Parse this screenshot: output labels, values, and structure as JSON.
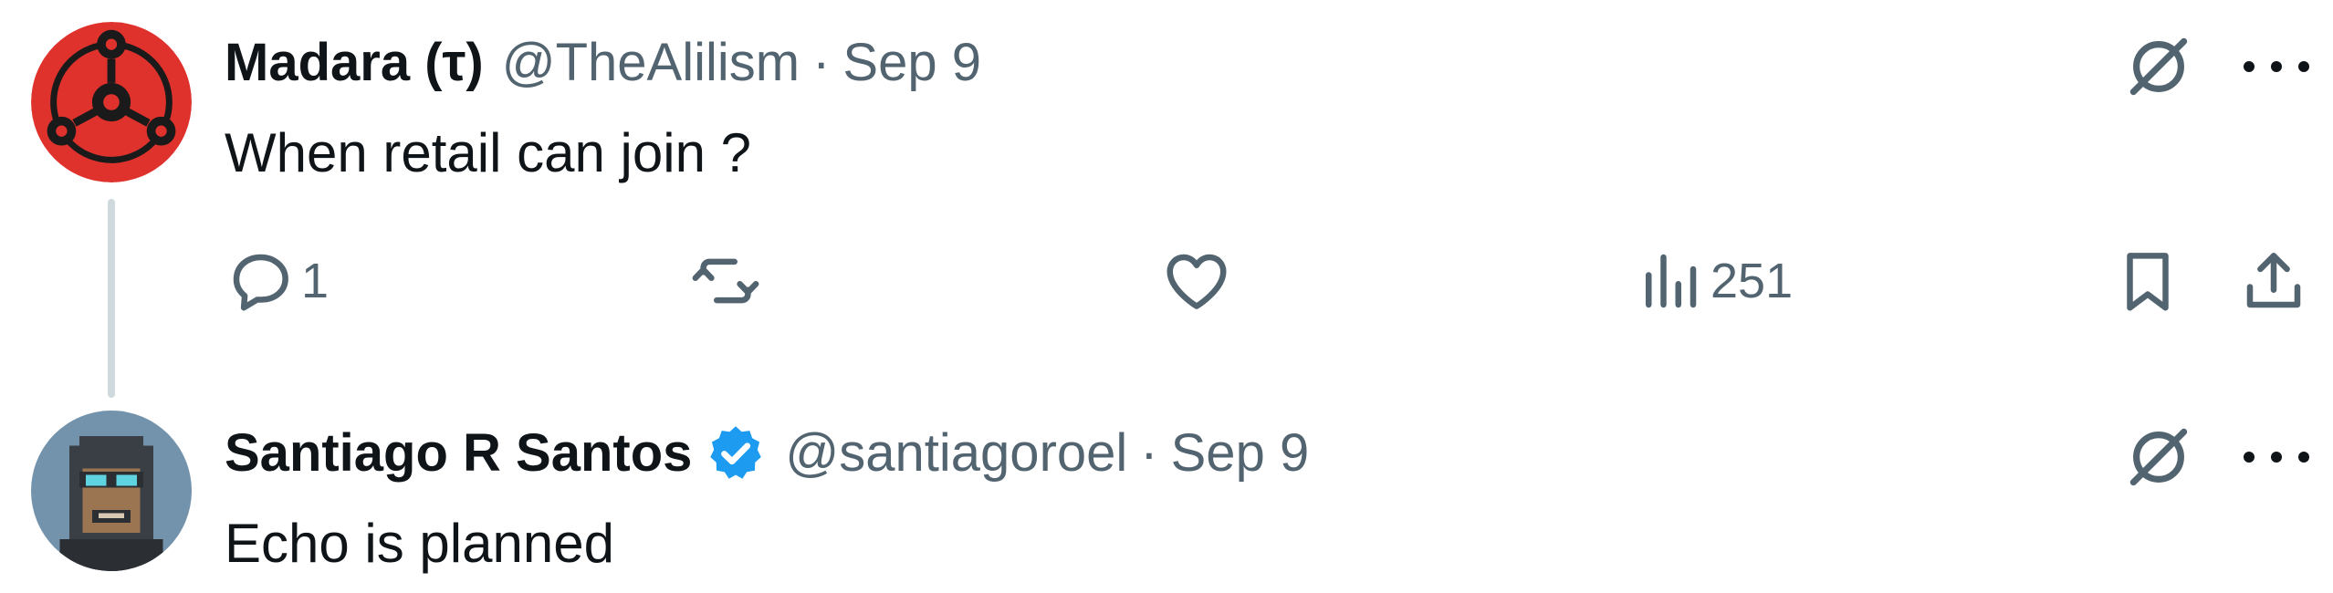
{
  "tweets": [
    {
      "display_name": "Madara (τ)",
      "handle": "@TheAlilism",
      "separator": "·",
      "time": "Sep 9",
      "text": "When retail can join ?",
      "avatar_icon": "sharingan-avatar",
      "verified": false,
      "actions": {
        "reply_count": "1",
        "views_count": "251"
      }
    },
    {
      "display_name": "Santiago R Santos",
      "handle": "@santiagoroel",
      "separator": "·",
      "time": "Sep 9",
      "text": "Echo is planned",
      "avatar_icon": "pixel-hooded-figure-avatar",
      "verified": true,
      "verified_icon": "verified-badge-icon"
    }
  ],
  "colors": {
    "text_primary": "#0f1419",
    "text_secondary": "#536471",
    "verified_blue": "#1d9bf0",
    "thread_line": "#cfd9de",
    "avatar_red": "#e0322d"
  },
  "icons": {
    "grok": "grok-icon",
    "more": "more-options-icon",
    "reply": "reply-icon",
    "retweet": "retweet-icon",
    "like": "heart-icon",
    "views": "views-chart-icon",
    "bookmark": "bookmark-icon",
    "share": "share-icon"
  }
}
